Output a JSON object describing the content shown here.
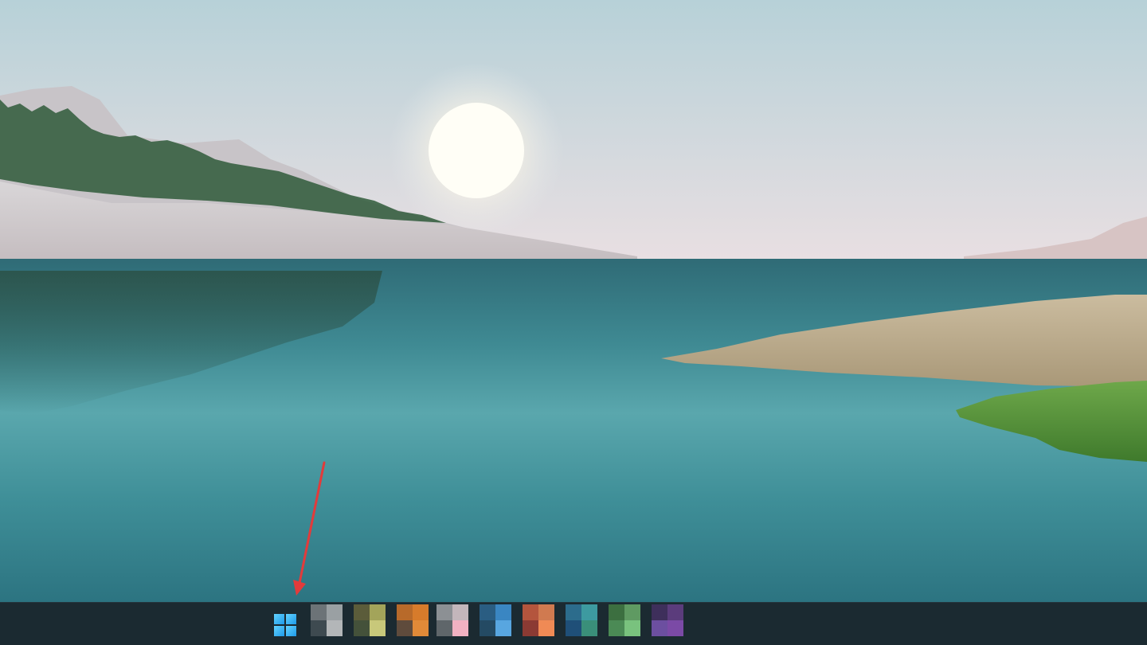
{
  "wallpaper": {
    "sky_top": "#b9d2d9",
    "sky_bottom": "#e8dde0",
    "sun": "#fffbe8",
    "lake_top": "#2f6f78",
    "lake_mid": "#4f9ea5",
    "lake_bottom": "#2f7a86",
    "mountain": "#cfcfd2",
    "trees": "#2f5a3a",
    "grass_dry": "#b8a98c",
    "grass_green": "#5e9a3e"
  },
  "taskbar": {
    "background": "#1b2a31",
    "start_button": {
      "icon": "windows-logo-icon",
      "accent": "#38b6f5"
    },
    "pinned_apps": [
      {
        "name": "pinned-app-1",
        "colors": [
          "#6c7377",
          "#9aa0a3",
          "#3e4a50",
          "#b3b6b8"
        ]
      },
      {
        "name": "pinned-app-2",
        "colors": [
          "#5b5c3a",
          "#a3a45a",
          "#44513a",
          "#c8c87a"
        ]
      },
      {
        "name": "pinned-app-3",
        "colors": [
          "#b86a2a",
          "#d77b2b",
          "#5f4b3c",
          "#e18a38"
        ]
      },
      {
        "name": "pinned-app-4",
        "colors": [
          "#8c9094",
          "#c3b6bb",
          "#5f666a",
          "#f1b1c2"
        ]
      },
      {
        "name": "pinned-app-5",
        "colors": [
          "#2a5d82",
          "#3a86c2",
          "#244a63",
          "#58a6e0"
        ]
      },
      {
        "name": "pinned-app-6",
        "colors": [
          "#b4553d",
          "#d07a50",
          "#8b3a33",
          "#f08a55"
        ]
      },
      {
        "name": "pinned-app-7",
        "colors": [
          "#2c6c8c",
          "#3d9aa0",
          "#1f4f78",
          "#3a8f7a"
        ]
      },
      {
        "name": "pinned-app-8",
        "colors": [
          "#3c6f40",
          "#5f9a62",
          "#4b8a55",
          "#79c27e"
        ]
      },
      {
        "name": "pinned-app-9",
        "colors": [
          "#3e2f5b",
          "#5b3c7c",
          "#6c4fa0",
          "#7b4aa6"
        ]
      }
    ]
  },
  "annotation": {
    "type": "red-arrow",
    "color": "#e23b3b",
    "points_to": "start-button"
  }
}
